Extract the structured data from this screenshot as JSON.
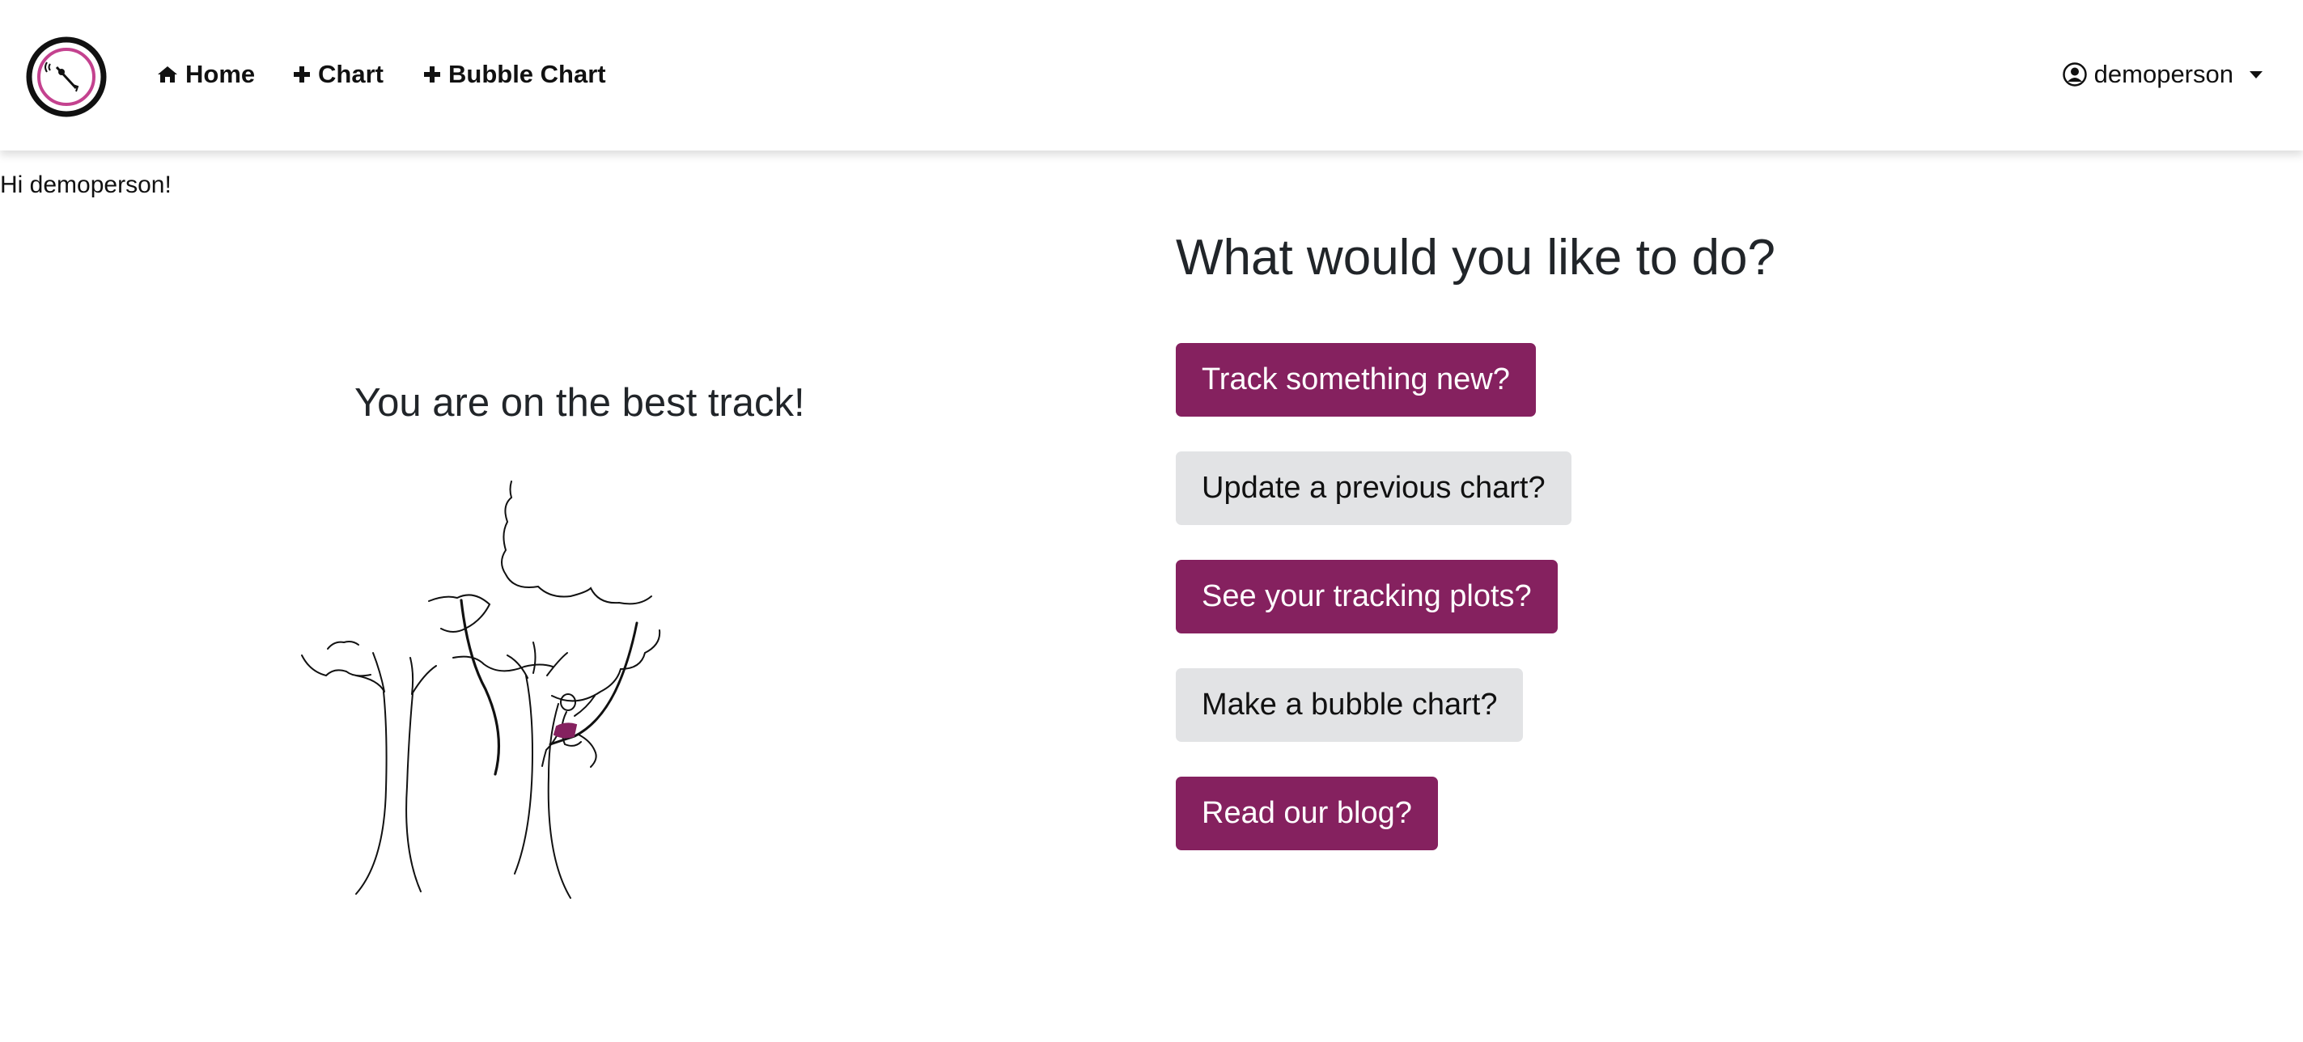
{
  "nav": {
    "home_label": "Home",
    "chart_label": "Chart",
    "bubble_chart_label": "Bubble Chart",
    "user_name": "demoperson"
  },
  "main": {
    "greeting": "Hi demoperson!",
    "tagline": "You are on the best track!",
    "prompt": "What would you like to do?",
    "actions": [
      {
        "label": "Track something new?",
        "style": "primary"
      },
      {
        "label": "Update a previous chart?",
        "style": "secondary"
      },
      {
        "label": "See your tracking plots?",
        "style": "primary"
      },
      {
        "label": "Make a bubble chart?",
        "style": "secondary"
      },
      {
        "label": "Read our blog?",
        "style": "primary"
      }
    ]
  },
  "colors": {
    "accent": "#85215f",
    "secondary_button": "#e2e3e5",
    "text": "#212529"
  },
  "icons": [
    "logo",
    "home-icon",
    "plus-icon",
    "user-circle-icon",
    "caret-down-icon"
  ]
}
